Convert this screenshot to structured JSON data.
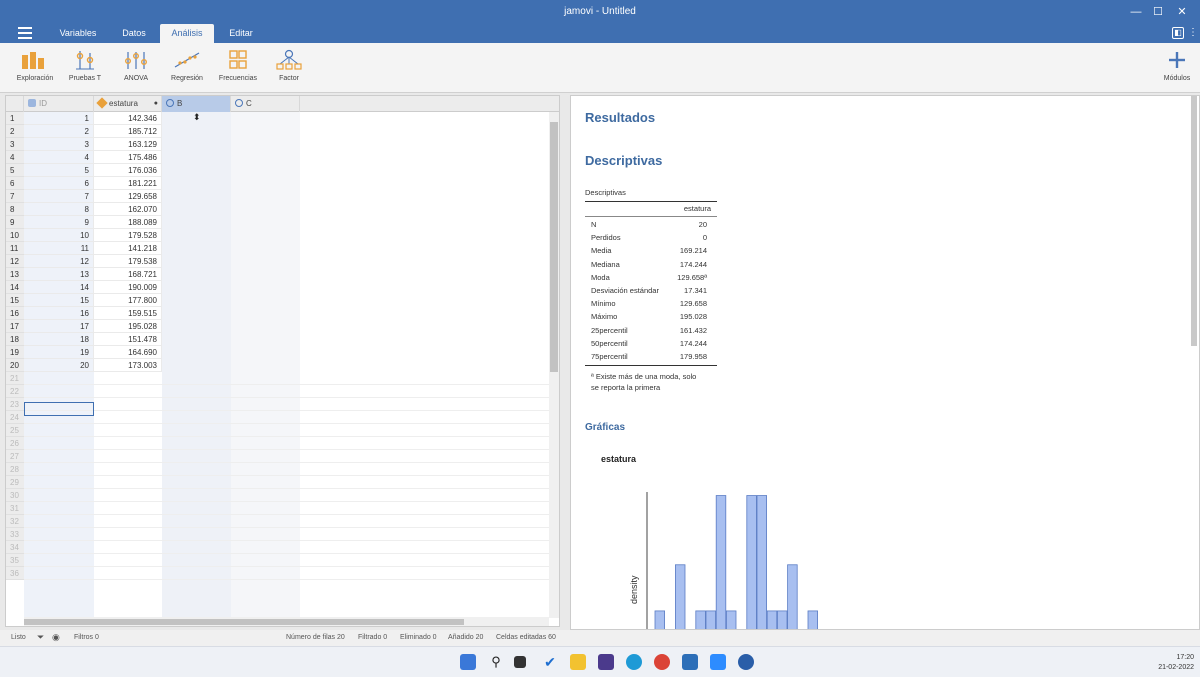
{
  "window": {
    "title": "jamovi - Untitled"
  },
  "menu": {
    "tabs": [
      "Variables",
      "Datos",
      "Análisis",
      "Editar"
    ],
    "active": "Análisis"
  },
  "toolbar": {
    "items": [
      "Exploración",
      "Pruebas T",
      "ANOVA",
      "Regresión",
      "Frecuencias",
      "Factor"
    ],
    "modules_label": "Módulos"
  },
  "sheet": {
    "columns": [
      "ID",
      "estatura",
      "B",
      "C"
    ],
    "rows": [
      [
        "1",
        "142.346"
      ],
      [
        "2",
        "185.712"
      ],
      [
        "3",
        "163.129"
      ],
      [
        "4",
        "175.486"
      ],
      [
        "5",
        "176.036"
      ],
      [
        "6",
        "181.221"
      ],
      [
        "7",
        "129.658"
      ],
      [
        "8",
        "162.070"
      ],
      [
        "9",
        "188.089"
      ],
      [
        "10",
        "179.528"
      ],
      [
        "11",
        "141.218"
      ],
      [
        "12",
        "179.538"
      ],
      [
        "13",
        "168.721"
      ],
      [
        "14",
        "190.009"
      ],
      [
        "15",
        "177.800"
      ],
      [
        "16",
        "159.515"
      ],
      [
        "17",
        "195.028"
      ],
      [
        "18",
        "151.478"
      ],
      [
        "19",
        "164.690"
      ],
      [
        "20",
        "173.003"
      ]
    ],
    "empty_row_numbers": [
      "21",
      "22",
      "23",
      "24",
      "25",
      "26",
      "27",
      "28",
      "29",
      "30",
      "31",
      "32",
      "33",
      "34",
      "35",
      "36"
    ]
  },
  "results": {
    "title": "Resultados",
    "section": "Descriptivas",
    "table_caption": "Descriptivas",
    "table_column": "estatura",
    "stats": [
      {
        "label": "N",
        "value": "20"
      },
      {
        "label": "Perdidos",
        "value": "0"
      },
      {
        "label": "Media",
        "value": "169.214"
      },
      {
        "label": "Mediana",
        "value": "174.244"
      },
      {
        "label": "Moda",
        "value": "129.658ª"
      },
      {
        "label": "Desviación estándar",
        "value": "17.341"
      },
      {
        "label": "Mínimo",
        "value": "129.658"
      },
      {
        "label": "Máximo",
        "value": "195.028"
      },
      {
        "label": "25percentil",
        "value": "161.432"
      },
      {
        "label": "50percentil",
        "value": "174.244"
      },
      {
        "label": "75percentil",
        "value": "179.958"
      }
    ],
    "footnote_line1": "ª Existe más de una moda, solo",
    "footnote_line2": "se reporta la primera",
    "plots_title": "Gráficas"
  },
  "chart_data": {
    "type": "bar",
    "title": "estatura",
    "ylabel": "density",
    "values": [
      1,
      0,
      3,
      0,
      1,
      1,
      6,
      1,
      0,
      6,
      6,
      1,
      1,
      3,
      0,
      1
    ],
    "ylim": [
      0,
      6.5
    ],
    "color": "#a8bff0"
  },
  "status": {
    "ready": "Listo",
    "filters": "Filtros 0",
    "rows": "Número de filas 20",
    "filtered": "Filtrado 0",
    "deleted": "Eliminado 0",
    "added": "Añadido 20",
    "edited": "Celdas editadas 60"
  },
  "clock": {
    "time": "17:20",
    "date": "21-02-2022"
  },
  "colors": {
    "brand": "#3f6fb1",
    "heading": "#3e6aa0",
    "selected_col": "#b8cbe8"
  }
}
